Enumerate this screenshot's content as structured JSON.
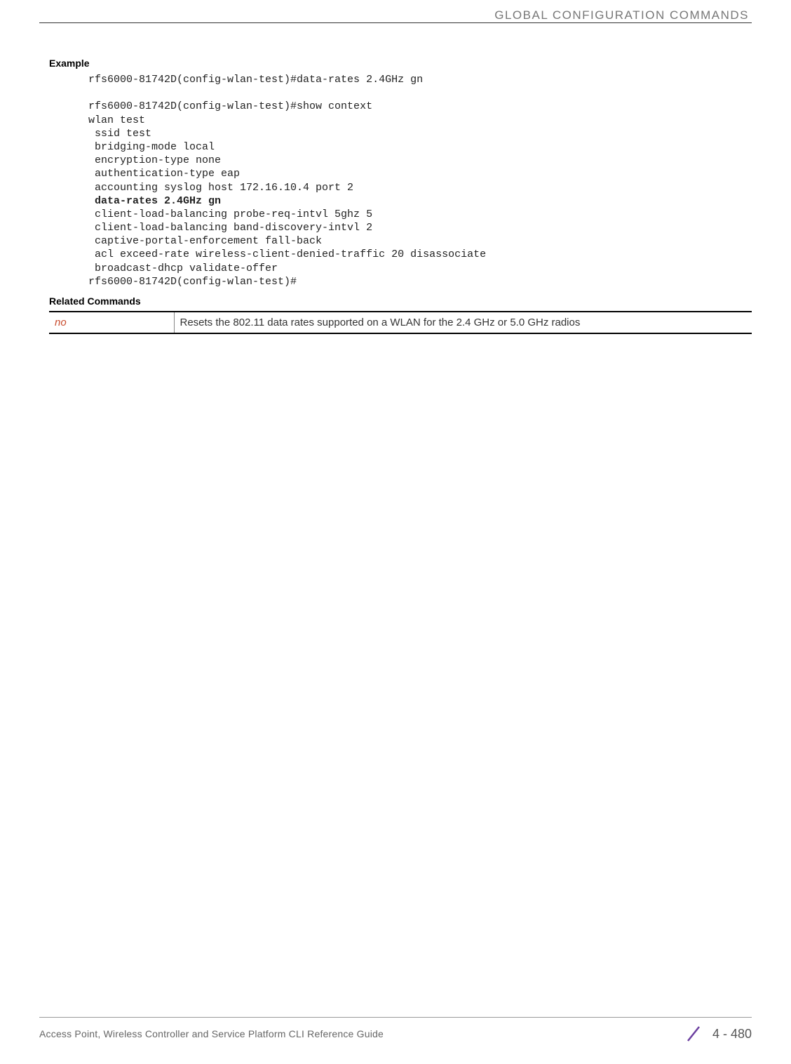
{
  "header": {
    "title": "GLOBAL CONFIGURATION COMMANDS"
  },
  "sections": {
    "example_heading": "Example",
    "related_commands_heading": "Related Commands"
  },
  "code": {
    "line1": "rfs6000-81742D(config-wlan-test)#data-rates 2.4GHz gn",
    "line2": "",
    "line3": "rfs6000-81742D(config-wlan-test)#show context",
    "line4": "wlan test",
    "line5": " ssid test",
    "line6": " bridging-mode local",
    "line7": " encryption-type none",
    "line8": " authentication-type eap",
    "line9": " accounting syslog host 172.16.10.4 port 2",
    "line10_bold": " data-rates 2.4GHz gn",
    "line11": " client-load-balancing probe-req-intvl 5ghz 5",
    "line12": " client-load-balancing band-discovery-intvl 2",
    "line13": " captive-portal-enforcement fall-back",
    "line14": " acl exceed-rate wireless-client-denied-traffic 20 disassociate",
    "line15": " broadcast-dhcp validate-offer",
    "line16": "rfs6000-81742D(config-wlan-test)#"
  },
  "related_table": {
    "cmd": "no",
    "desc": "Resets the 802.11 data rates supported on a WLAN for the 2.4 GHz or 5.0 GHz radios"
  },
  "footer": {
    "left": "Access Point, Wireless Controller and Service Platform CLI Reference Guide",
    "page": "4 - 480"
  }
}
